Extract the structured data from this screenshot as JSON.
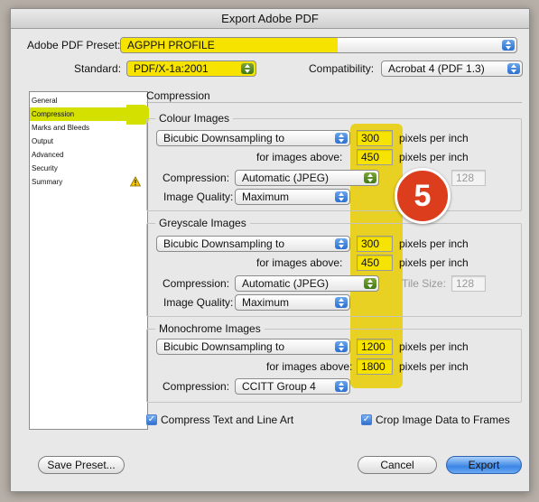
{
  "window_title": "Export Adobe PDF",
  "preset": {
    "label": "Adobe PDF Preset:",
    "value": "AGPPH PROFILE"
  },
  "standard": {
    "label": "Standard:",
    "value": "PDF/X-1a:2001"
  },
  "compatibility": {
    "label": "Compatibility:",
    "value": "Acrobat 4 (PDF 1.3)"
  },
  "sidebar": {
    "items": [
      {
        "label": "General"
      },
      {
        "label": "Compression"
      },
      {
        "label": "Marks and Bleeds"
      },
      {
        "label": "Output"
      },
      {
        "label": "Advanced"
      },
      {
        "label": "Security"
      },
      {
        "label": "Summary"
      }
    ]
  },
  "panel_title": "Compression",
  "colour": {
    "title": "Colour Images",
    "downsampling": "Bicubic Downsampling to",
    "ppi": "300",
    "ppi_unit": "pixels per inch",
    "above_label": "for images above:",
    "above": "450",
    "above_unit": "pixels per inch",
    "compression_label": "Compression:",
    "compression": "Automatic (JPEG)",
    "tile_value": "128",
    "quality_label": "Image Quality:",
    "quality": "Maximum"
  },
  "greyscale": {
    "title": "Greyscale Images",
    "downsampling": "Bicubic Downsampling to",
    "ppi": "300",
    "ppi_unit": "pixels per inch",
    "above_label": "for images above:",
    "above": "450",
    "above_unit": "pixels per inch",
    "compression_label": "Compression:",
    "compression": "Automatic (JPEG)",
    "tile_label": "Tile Size:",
    "tile_value": "128",
    "quality_label": "Image Quality:",
    "quality": "Maximum"
  },
  "mono": {
    "title": "Monochrome Images",
    "downsampling": "Bicubic Downsampling to",
    "ppi": "1200",
    "ppi_unit": "pixels per inch",
    "above_label": "for images above:",
    "above": "1800",
    "above_unit": "pixels per inch",
    "compression_label": "Compression:",
    "compression": "CCITT Group 4"
  },
  "options": {
    "compress_text": "Compress Text and Line Art",
    "crop_image": "Crop Image Data to Frames"
  },
  "buttons": {
    "save_preset": "Save Preset...",
    "cancel": "Cancel",
    "export": "Export"
  },
  "annotation": {
    "number": "5"
  },
  "colors": {
    "highlight": "#f7e300",
    "badge": "#dc3d1c",
    "accent": "#3c86e6"
  }
}
